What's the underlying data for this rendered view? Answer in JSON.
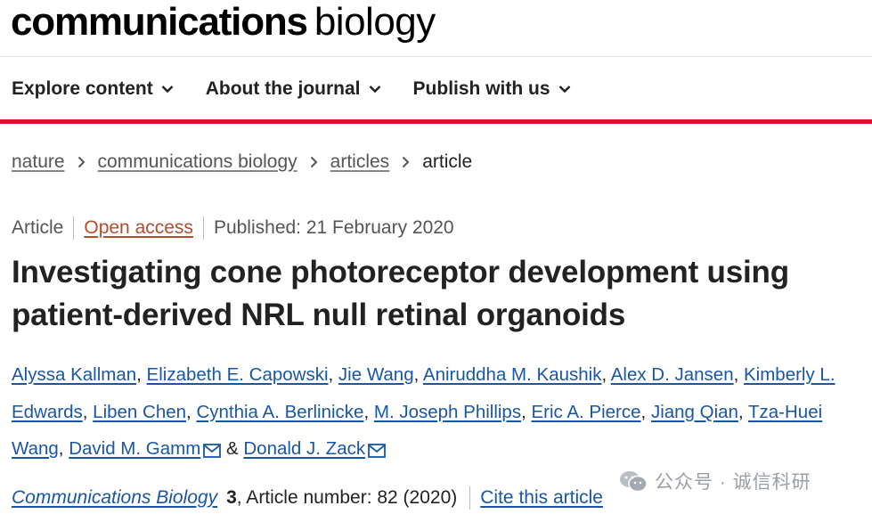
{
  "logo": {
    "bold": "communications",
    "light": "biology"
  },
  "nav": {
    "items": [
      {
        "label": "Explore content"
      },
      {
        "label": "About the journal"
      },
      {
        "label": "Publish with us"
      }
    ]
  },
  "breadcrumb": {
    "items": [
      "nature",
      "communications biology",
      "articles"
    ],
    "current": "article"
  },
  "meta": {
    "type": "Article",
    "access": "Open access",
    "published": "Published: 21 February 2020"
  },
  "title": "Investigating cone photoreceptor development using patient-derived NRL null retinal organoids",
  "authors": [
    "Alyssa Kallman",
    "Elizabeth E. Capowski",
    "Jie Wang",
    "Aniruddha M. Kaushik",
    "Alex D. Jansen",
    "Kimberly L. Edwards",
    "Liben Chen",
    "Cynthia A. Berlinicke",
    "M. Joseph Phillips",
    "Eric A. Pierce",
    "Jiang Qian",
    "Tza-Huei Wang",
    "David M. Gamm",
    "Donald J. Zack"
  ],
  "authors_conjunction": "&",
  "citation": {
    "journal": "Communications Biology",
    "volume": "3",
    "article_number": ", Article number: 82 (2020)",
    "cite_label": "Cite this article"
  },
  "watermark": {
    "text": "公众号 · 诚信科研",
    "icon": "wechat-icon"
  },
  "colors": {
    "accent_red": "#d7142b",
    "link_blue": "#1a56a6",
    "open_access": "#b24c2e"
  }
}
